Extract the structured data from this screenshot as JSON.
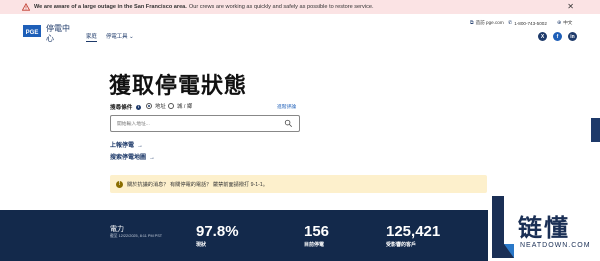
{
  "alert": {
    "bold": "We are aware of a large outage in the San Francisco area.",
    "text": "Our crews are working as quickly and safely as possible to restore service."
  },
  "header": {
    "brand_line1": "停電中",
    "brand_line2": "心",
    "nav_home": "家庭",
    "nav_tools": "停電工具",
    "util_site": "造訪 pge.com",
    "util_phone": "1-800-743-5002",
    "util_lang": "中文",
    "social": [
      "X",
      "f",
      "in"
    ]
  },
  "main": {
    "title": "獲取停電狀態",
    "search_label": "搜尋條件",
    "radio_address": "地址",
    "radio_city": "城 / 鄉",
    "advanced": "進階評論",
    "search_placeholder": "開始輸入地址...",
    "link_report": "上報停電",
    "link_map": "搜索停電地圖"
  },
  "notice": {
    "text": "關於抗議的消息？ 有關停電的電話？ 嚴禁前面請撥打 9-1-1。"
  },
  "stats": {
    "label": "電力",
    "updated": "截至 12/22/2025, 8:11 PM PST",
    "items": [
      {
        "value": "97.8%",
        "caption": "現狀"
      },
      {
        "value": "156",
        "caption": "目前停電"
      },
      {
        "value": "125,421",
        "caption": "受影響的客戶"
      }
    ]
  },
  "watermark": {
    "cn": "链懂",
    "en": "NEATDOWN.COM"
  },
  "colors": {
    "alert_bg": "#fbe3e4",
    "brand_navy": "#13294b",
    "link_blue": "#1e5fb8",
    "notice_bg": "#fdf0cc"
  }
}
